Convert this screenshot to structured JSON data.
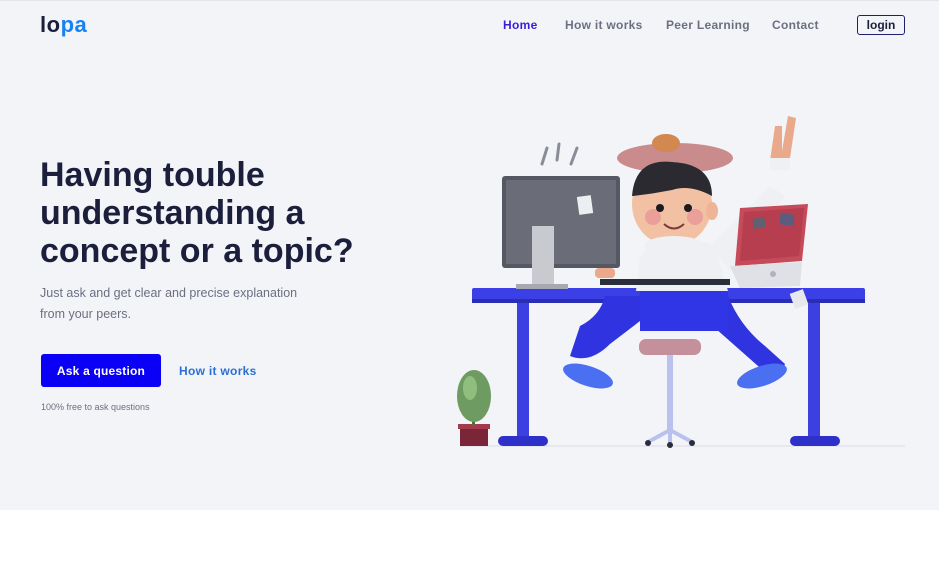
{
  "brand": {
    "logo_part1": "lo",
    "logo_part2": "pa"
  },
  "nav": {
    "items": [
      {
        "label": "Home",
        "active": true
      },
      {
        "label": "How it works",
        "active": false
      },
      {
        "label": "Peer Learning",
        "active": false
      },
      {
        "label": "Contact",
        "active": false
      }
    ],
    "login_label": "login"
  },
  "hero": {
    "headline_lines": [
      "Having touble",
      "understanding a",
      "concept or a topic?"
    ],
    "subtitle_lines": [
      "Just ask and get clear and precise explanation",
      "from your peers."
    ],
    "primary_cta": "Ask a question",
    "secondary_cta": "How it works",
    "note": "100% free to ask questions"
  },
  "colors": {
    "brand_dark": "#1b1f3b",
    "brand_blue": "#1683f0",
    "primary_button": "#0a00f5",
    "nav_active": "#3d1cd9",
    "hero_bg": "#f3f4f8"
  },
  "illustration": {
    "icon": "student-at-desk-illustration"
  }
}
